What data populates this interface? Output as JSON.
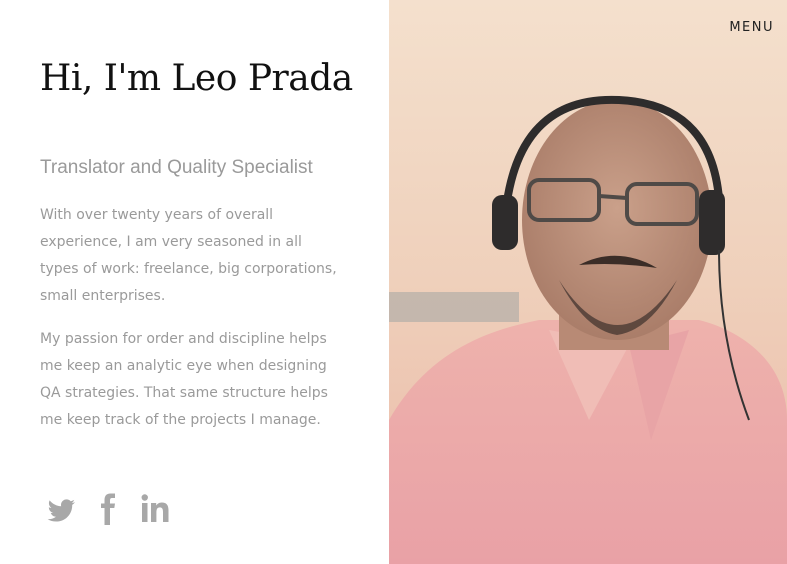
{
  "nav": {
    "menu_label": "MENU"
  },
  "intro": {
    "heading": "Hi, I'm Leo Prada",
    "subtitle": "Translator and Quality Specialist",
    "paragraphs": [
      "With over twenty years of overall experience, I am very seasoned in all types of work: freelance, big corporations, small enterprises.",
      "My passion for order and discipline helps me keep an analytic eye when designing QA strategies. That same structure helps me keep track of the projects I manage."
    ]
  },
  "social": {
    "icons": [
      "twitter-icon",
      "facebook-icon",
      "linkedin-icon"
    ],
    "icon_color": "#9e9e9e"
  },
  "photo": {
    "subject": "profile-photo",
    "background_color": "#f1d6c1",
    "shirt_color": "#e9a6a8"
  },
  "colors": {
    "heading": "#111111",
    "muted_text": "#9a9a9a",
    "menu_text": "#222222"
  }
}
